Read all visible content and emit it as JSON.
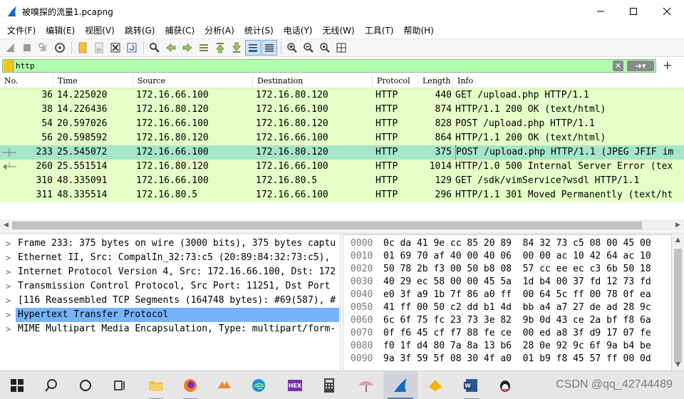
{
  "window": {
    "title": "被嗅探的流量1.pcapng"
  },
  "menu": [
    "文件(F)",
    "编辑(E)",
    "视图(V)",
    "跳转(G)",
    "捕获(C)",
    "分析(A)",
    "统计(S)",
    "电话(Y)",
    "无线(W)",
    "工具(T)",
    "帮助(H)"
  ],
  "toolbar": {
    "icons": [
      "start-capture-icon",
      "stop-capture-icon",
      "restart-capture-icon",
      "capture-options-icon",
      "open-file-icon",
      "save-file-icon",
      "close-file-icon",
      "reload-file-icon",
      "find-packet-icon",
      "go-back-icon",
      "go-forward-icon",
      "go-to-packet-icon",
      "first-packet-icon",
      "last-packet-icon",
      "auto-scroll-icon",
      "colorize-icon",
      "zoom-in-icon",
      "zoom-out-icon",
      "normal-size-icon",
      "resize-columns-icon"
    ]
  },
  "filter": {
    "value": "http"
  },
  "packet_list": {
    "columns": [
      "No.",
      "Time",
      "Source",
      "Destination",
      "Protocol",
      "Length",
      "Info"
    ],
    "rows": [
      {
        "no": "36",
        "time": "14.225020",
        "src": "172.16.66.100",
        "dst": "172.16.80.120",
        "proto": "HTTP",
        "len": "440",
        "info": "GET /upload.php HTTP/1.1"
      },
      {
        "no": "38",
        "time": "14.226436",
        "src": "172.16.80.120",
        "dst": "172.16.66.100",
        "proto": "HTTP",
        "len": "874",
        "info": "HTTP/1.1 200 OK  (text/html)"
      },
      {
        "no": "54",
        "time": "20.597026",
        "src": "172.16.66.100",
        "dst": "172.16.80.120",
        "proto": "HTTP",
        "len": "828",
        "info": "POST /upload.php HTTP/1.1"
      },
      {
        "no": "56",
        "time": "20.598592",
        "src": "172.16.80.120",
        "dst": "172.16.66.100",
        "proto": "HTTP",
        "len": "864",
        "info": "HTTP/1.1 200 OK  (text/html)"
      },
      {
        "no": "233",
        "time": "25.545072",
        "src": "172.16.66.100",
        "dst": "172.16.80.120",
        "proto": "HTTP",
        "len": "375",
        "info": "POST /upload.php HTTP/1.1  (JPEG JFIF im"
      },
      {
        "no": "260",
        "time": "25.551514",
        "src": "172.16.80.120",
        "dst": "172.16.66.100",
        "proto": "HTTP",
        "len": "1014",
        "info": "HTTP/1.0 500 Internal Server Error  (tex"
      },
      {
        "no": "310",
        "time": "48.335091",
        "src": "172.16.66.100",
        "dst": "172.16.80.5",
        "proto": "HTTP",
        "len": "129",
        "info": "GET /sdk/vimService?wsdl HTTP/1.1"
      },
      {
        "no": "311",
        "time": "48.335514",
        "src": "172.16.80.5",
        "dst": "172.16.66.100",
        "proto": "HTTP",
        "len": "296",
        "info": "HTTP/1.1 301 Moved Permanently  (text/ht"
      }
    ]
  },
  "details": [
    "Frame 233: 375 bytes on wire (3000 bits), 375 bytes captu",
    "Ethernet II, Src: CompalIn_32:73:c5 (20:89:84:32:73:c5),",
    "Internet Protocol Version 4, Src: 172.16.66.100, Dst: 172",
    "Transmission Control Protocol, Src Port: 11251, Dst Port",
    "[116 Reassembled TCP Segments (164748 bytes): #69(587), #",
    "Hypertext Transfer Protocol",
    "MIME Multipart Media Encapsulation, Type: multipart/form-"
  ],
  "bytes": [
    {
      "off": "0000",
      "hex": "0c da 41 9e cc 85 20 89  84 32 73 c5 08 00 45 00"
    },
    {
      "off": "0010",
      "hex": "01 69 70 af 40 00 40 06  00 00 ac 10 42 64 ac 10"
    },
    {
      "off": "0020",
      "hex": "50 78 2b f3 00 50 b8 08  57 cc ee ec c3 6b 50 18"
    },
    {
      "off": "0030",
      "hex": "40 29 ec 58 00 00 45 5a  1d b4 00 37 fd 12 73 fd"
    },
    {
      "off": "0040",
      "hex": "e0 3f a9 1b 7f 86 a0 ff  00 64 5c ff 00 78 0f ea"
    },
    {
      "off": "0050",
      "hex": "41 ff 00 50 c2 dd b1 4d  bb a4 a7 27 de ad 28 9c"
    },
    {
      "off": "0060",
      "hex": "6c 6f 75 fc 23 73 3e 82  9b 0d 43 ce 2a bf f8 6a"
    },
    {
      "off": "0070",
      "hex": "0f f6 45 cf f7 88 fe ce  00 ed a8 3f d9 17 07 fe"
    },
    {
      "off": "0080",
      "hex": "f0 1f d4 80 7a 8a 13 b6  28 0e 92 9c 6f 9a b4 be"
    },
    {
      "off": "0090",
      "hex": "9a 3f 59 5f 08 30 4f a0  01 b9 f8 45 57 ff 00 0d"
    }
  ],
  "taskbar": {
    "watermark": "CSDN @qq_42744489",
    "hex_label": "HEX"
  }
}
